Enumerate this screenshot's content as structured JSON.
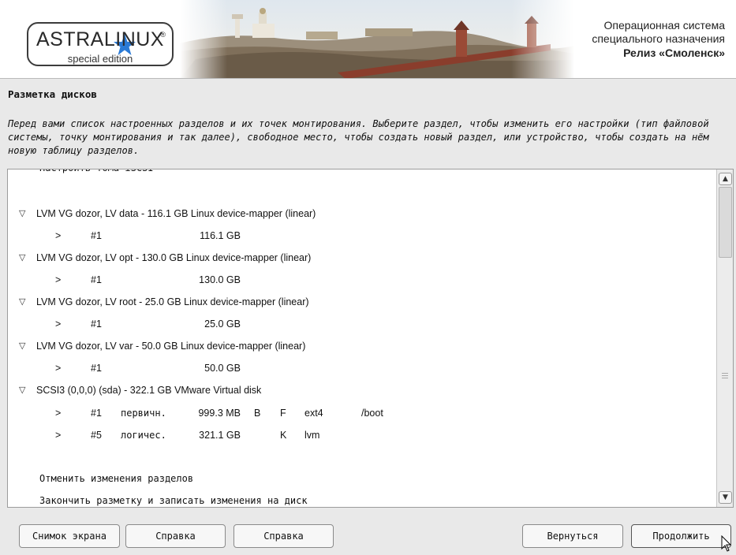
{
  "header": {
    "logo_main": "ASTRALINUX",
    "logo_reg": "®",
    "logo_sub": "special edition",
    "os_line1": "Операционная система",
    "os_line2": "специального назначения",
    "os_release": "Релиз «Смоленск»"
  },
  "page": {
    "title": "Разметка дисков",
    "description": "Перед вами список настроенных разделов и их точек монтирования. Выберите раздел, чтобы изменить его настройки (тип файловой системы, точку монтирования и так далее), свободное место, чтобы создать новый раздел, или устройство, чтобы создать на нём новую таблицу разделов."
  },
  "list": {
    "cut_item": "Настроить тома iSCSI",
    "groups": [
      {
        "label": "LVM VG dozor, LV data - 116.1 GB Linux device-mapper (linear)",
        "partitions": [
          {
            "arrow": ">",
            "num": "#1",
            "type": "",
            "size": "116.1 GB",
            "flag1": "",
            "flag2": "",
            "fs": "",
            "mount": ""
          }
        ]
      },
      {
        "label": "LVM VG dozor, LV opt - 130.0 GB Linux device-mapper (linear)",
        "partitions": [
          {
            "arrow": ">",
            "num": "#1",
            "type": "",
            "size": "130.0 GB",
            "flag1": "",
            "flag2": "",
            "fs": "",
            "mount": ""
          }
        ]
      },
      {
        "label": "LVM VG dozor, LV root - 25.0 GB Linux device-mapper (linear)",
        "partitions": [
          {
            "arrow": ">",
            "num": "#1",
            "type": "",
            "size": "25.0 GB",
            "flag1": "",
            "flag2": "",
            "fs": "",
            "mount": ""
          }
        ]
      },
      {
        "label": "LVM VG dozor, LV var - 50.0 GB Linux device-mapper (linear)",
        "partitions": [
          {
            "arrow": ">",
            "num": "#1",
            "type": "",
            "size": "50.0 GB",
            "flag1": "",
            "flag2": "",
            "fs": "",
            "mount": ""
          }
        ]
      },
      {
        "label": "SCSI3 (0,0,0) (sda) - 322.1 GB VMware Virtual disk",
        "partitions": [
          {
            "arrow": ">",
            "num": "#1",
            "type": "первичн.",
            "size": "999.3 MB",
            "flag1": "B",
            "flag2": "F",
            "fs": "ext4",
            "mount": "/boot"
          },
          {
            "arrow": ">",
            "num": "#5",
            "type": "логичес.",
            "size": "321.1 GB",
            "flag1": "",
            "flag2": "K",
            "fs": "lvm",
            "mount": ""
          }
        ]
      }
    ],
    "actions": {
      "undo": "Отменить изменения разделов",
      "finish": "Закончить разметку и записать изменения на диск"
    }
  },
  "scrollbar": {
    "up_glyph": "▲",
    "down_glyph": "▼"
  },
  "buttons": {
    "screenshot": "Снимок экрана",
    "help1": "Справка",
    "help2": "Справка",
    "back": "Вернуться",
    "continue": "Продолжить"
  },
  "icons": {
    "triangle": "▽",
    "star_color": "#2a7ad6"
  }
}
